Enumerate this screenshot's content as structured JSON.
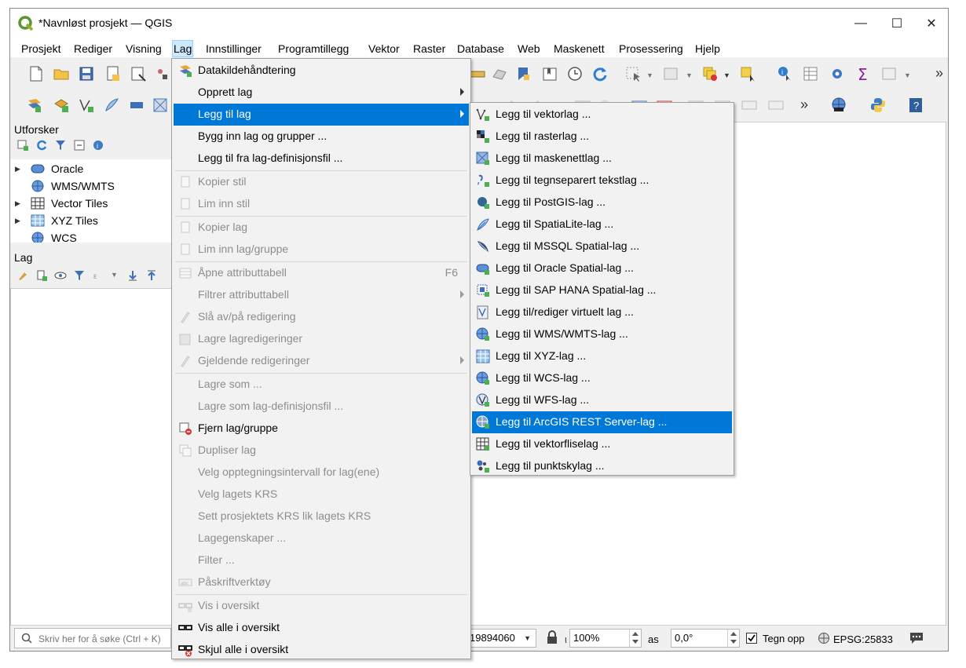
{
  "window": {
    "title": "*Navnløst prosjekt — QGIS",
    "minimize": "—",
    "maximize": "☐",
    "close": "✕"
  },
  "menubar": [
    "Prosjekt",
    "Rediger",
    "Visning",
    "Lag",
    "Innstillinger",
    "Programtillegg",
    "Vektor",
    "Raster",
    "Database",
    "Web",
    "Maskenett",
    "Prosessering",
    "Hjelp"
  ],
  "browser_panel": {
    "title": "Utforsker",
    "items": [
      "Oracle",
      "WMS/WMTS",
      "Vector Tiles",
      "XYZ Tiles",
      "WCS"
    ]
  },
  "layers_panel": {
    "title": "Lag"
  },
  "layer_menu": {
    "items": [
      {
        "label": "Datakildehåndtering",
        "shortcut": "",
        "enabled": true
      },
      {
        "label": "Opprett lag",
        "shortcut": "",
        "enabled": true
      },
      {
        "label": "Legg til lag",
        "shortcut": "",
        "enabled": true
      },
      {
        "label": "Bygg inn lag og grupper ...",
        "shortcut": "",
        "enabled": true
      },
      {
        "label": "Legg til fra lag-definisjonsfil ...",
        "shortcut": "",
        "enabled": true
      },
      {
        "label": "Kopier stil",
        "shortcut": "",
        "enabled": false
      },
      {
        "label": "Lim inn stil",
        "shortcut": "",
        "enabled": false
      },
      {
        "label": "Kopier lag",
        "shortcut": "",
        "enabled": false
      },
      {
        "label": "Lim inn lag/gruppe",
        "shortcut": "",
        "enabled": false
      },
      {
        "label": "Åpne attributtabell",
        "shortcut": "F6",
        "enabled": false
      },
      {
        "label": "Filtrer attributtabell",
        "shortcut": "",
        "enabled": false
      },
      {
        "label": "Slå av/på redigering",
        "shortcut": "",
        "enabled": false
      },
      {
        "label": "Lagre lagredigeringer",
        "shortcut": "",
        "enabled": false
      },
      {
        "label": "Gjeldende redigeringer",
        "shortcut": "",
        "enabled": false
      },
      {
        "label": "Lagre som ...",
        "shortcut": "",
        "enabled": false
      },
      {
        "label": "Lagre som lag-definisjonsfil ...",
        "shortcut": "",
        "enabled": false
      },
      {
        "label": "Fjern lag/gruppe",
        "shortcut": "",
        "enabled": true
      },
      {
        "label": "Dupliser lag",
        "shortcut": "",
        "enabled": false
      },
      {
        "label": "Velg opptegningsintervall for lag(ene)",
        "shortcut": "",
        "enabled": false
      },
      {
        "label": "Velg lagets KRS",
        "shortcut": "",
        "enabled": false
      },
      {
        "label": "Sett prosjektets KRS lik lagets KRS",
        "shortcut": "",
        "enabled": false
      },
      {
        "label": "Lagegenskaper ...",
        "shortcut": "",
        "enabled": false
      },
      {
        "label": "Filter ...",
        "shortcut": "",
        "enabled": false
      },
      {
        "label": "Påskriftverktøy",
        "shortcut": "",
        "enabled": false
      },
      {
        "label": "Vis i oversikt",
        "shortcut": "",
        "enabled": false
      },
      {
        "label": "Vis alle i oversikt",
        "shortcut": "",
        "enabled": true
      },
      {
        "label": "Skjul alle i oversikt",
        "shortcut": "",
        "enabled": true
      }
    ]
  },
  "add_layer_submenu": {
    "items": [
      "Legg til vektorlag ...",
      "Legg til rasterlag ...",
      "Legg til maskenettlag ...",
      "Legg til tegnseparert tekstlag ...",
      "Legg til PostGIS-lag ...",
      "Legg til SpatiaLite-lag ...",
      "Legg til MSSQL Spatial-lag ...",
      "Legg til Oracle Spatial-lag ...",
      "Legg til SAP HANA Spatial-lag ...",
      "Legg til/rediger virtuelt lag ...",
      "Legg til WMS/WMTS-lag ...",
      "Legg til XYZ-lag ...",
      "Legg til WCS-lag ...",
      "Legg til WFS-lag ...",
      "Legg til ArcGIS REST Server-lag ...",
      "Legg til vektorfliselag ...",
      "Legg til punktskylag ..."
    ],
    "highlighted": "Legg til ArcGIS REST Server-lag ..."
  },
  "statusbar": {
    "search_placeholder": "Skriv her for å søke (Ctrl + K)",
    "scale_value": "19894060",
    "magnifier_value": "100%",
    "rotation_label": "as",
    "rotation_value": "0,0°",
    "render_label": "Tegn opp",
    "crs": "EPSG:25833"
  },
  "toolbar": {
    "overflow": "»"
  },
  "colors": {
    "highlight": "#0078d7",
    "menu_bg": "#f2f2f2",
    "disabled_text": "#8d8d8d"
  }
}
